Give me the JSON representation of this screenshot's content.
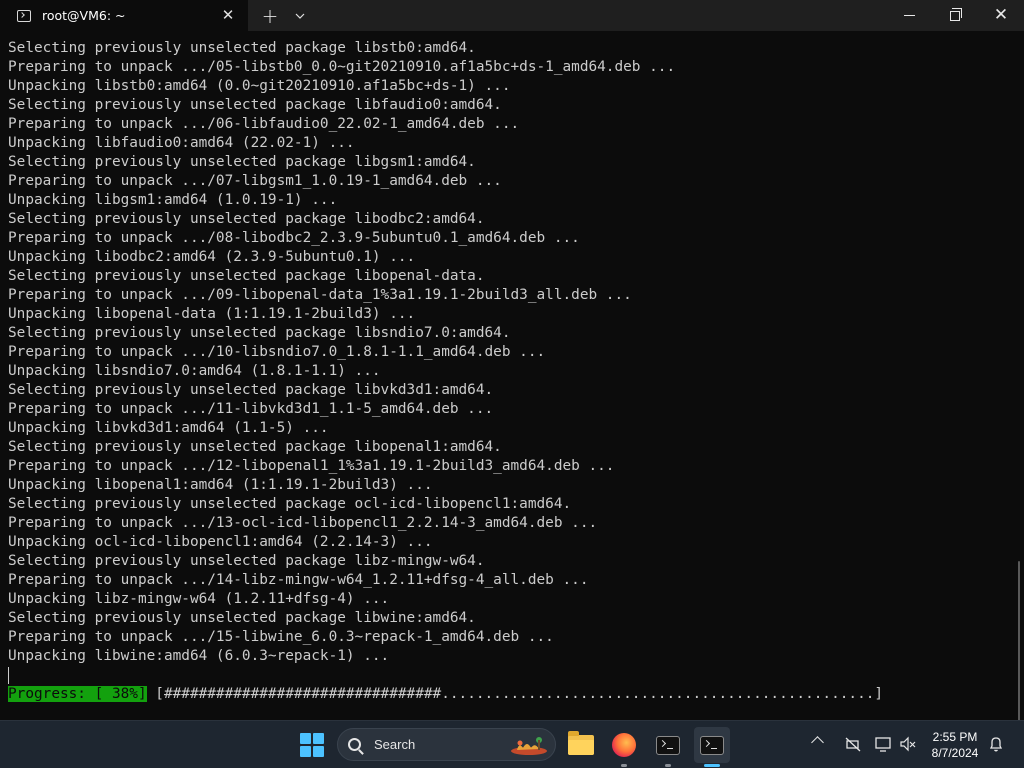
{
  "window": {
    "tab_title": "root@VM6: ~",
    "tab_close": "✕",
    "new_tab": "+",
    "dropdown": "⌄",
    "close": "✕"
  },
  "terminal": {
    "lines": [
      "Selecting previously unselected package libstb0:amd64.",
      "Preparing to unpack .../05-libstb0_0.0~git20210910.af1a5bc+ds-1_amd64.deb ...",
      "Unpacking libstb0:amd64 (0.0~git20210910.af1a5bc+ds-1) ...",
      "Selecting previously unselected package libfaudio0:amd64.",
      "Preparing to unpack .../06-libfaudio0_22.02-1_amd64.deb ...",
      "Unpacking libfaudio0:amd64 (22.02-1) ...",
      "Selecting previously unselected package libgsm1:amd64.",
      "Preparing to unpack .../07-libgsm1_1.0.19-1_amd64.deb ...",
      "Unpacking libgsm1:amd64 (1.0.19-1) ...",
      "Selecting previously unselected package libodbc2:amd64.",
      "Preparing to unpack .../08-libodbc2_2.3.9-5ubuntu0.1_amd64.deb ...",
      "Unpacking libodbc2:amd64 (2.3.9-5ubuntu0.1) ...",
      "Selecting previously unselected package libopenal-data.",
      "Preparing to unpack .../09-libopenal-data_1%3a1.19.1-2build3_all.deb ...",
      "Unpacking libopenal-data (1:1.19.1-2build3) ...",
      "Selecting previously unselected package libsndio7.0:amd64.",
      "Preparing to unpack .../10-libsndio7.0_1.8.1-1.1_amd64.deb ...",
      "Unpacking libsndio7.0:amd64 (1.8.1-1.1) ...",
      "Selecting previously unselected package libvkd3d1:amd64.",
      "Preparing to unpack .../11-libvkd3d1_1.1-5_amd64.deb ...",
      "Unpacking libvkd3d1:amd64 (1.1-5) ...",
      "Selecting previously unselected package libopenal1:amd64.",
      "Preparing to unpack .../12-libopenal1_1%3a1.19.1-2build3_amd64.deb ...",
      "Unpacking libopenal1:amd64 (1:1.19.1-2build3) ...",
      "Selecting previously unselected package ocl-icd-libopencl1:amd64.",
      "Preparing to unpack .../13-ocl-icd-libopencl1_2.2.14-3_amd64.deb ...",
      "Unpacking ocl-icd-libopencl1:amd64 (2.2.14-3) ...",
      "Selecting previously unselected package libz-mingw-w64.",
      "Preparing to unpack .../14-libz-mingw-w64_1.2.11+dfsg-4_all.deb ...",
      "Unpacking libz-mingw-w64 (1.2.11+dfsg-4) ...",
      "Selecting previously unselected package libwine:amd64.",
      "Preparing to unpack .../15-libwine_6.0.3~repack-1_amd64.deb ...",
      "Unpacking libwine:amd64 (6.0.3~repack-1) ..."
    ],
    "progress_label": "Progress: [ 38%]",
    "progress_bar": " [################################..................................................]",
    "progress_fraction": 0.38
  },
  "taskbar": {
    "search_placeholder": "Search",
    "time": "2:55 PM",
    "date": "8/7/2024"
  },
  "colors": {
    "terminal_bg": "#0c0c0c",
    "terminal_fg": "#cccccc",
    "progress_green": "#13a10e",
    "taskbar_bg": "#1e2630",
    "accent": "#4cc2ff"
  }
}
